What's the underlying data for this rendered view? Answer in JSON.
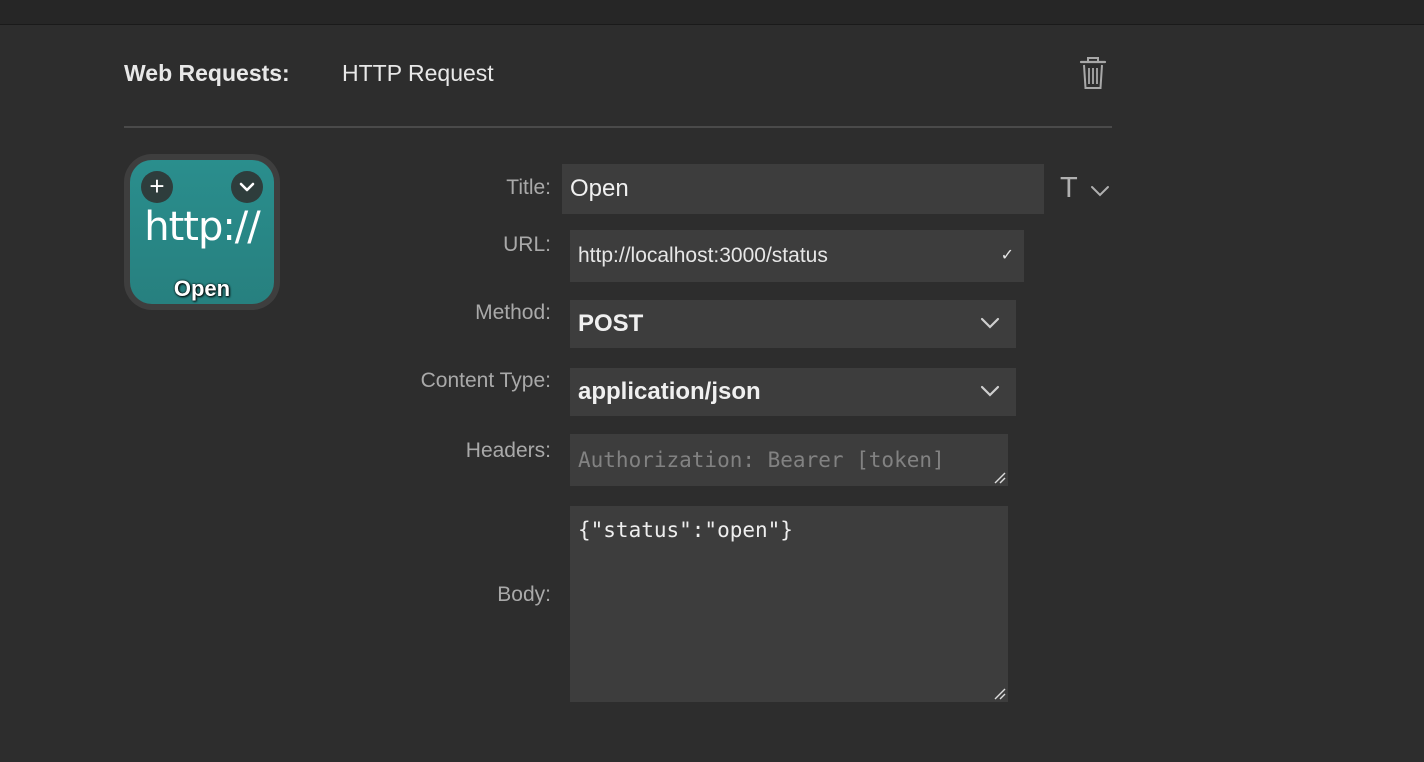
{
  "header": {
    "category": "Web Requests:",
    "action": "HTTP Request"
  },
  "key": {
    "glyph": "http://",
    "label": "Open",
    "color": "#2a8e8d"
  },
  "form": {
    "title_label": "Title:",
    "title_value": "Open",
    "url_label": "URL:",
    "url_value": "http://localhost:3000/status",
    "method_label": "Method:",
    "method_value": "POST",
    "content_type_label": "Content Type:",
    "content_type_value": "application/json",
    "headers_label": "Headers:",
    "headers_placeholder": "Authorization: Bearer [token]",
    "body_label": "Body:",
    "body_value": "{\"status\":\"open\"}"
  },
  "icons": {
    "trash": "trash-icon",
    "plus": "plus-icon",
    "chevron": "chevron-down-icon",
    "text_style": "text-style-icon",
    "check": "checkmark-icon"
  }
}
